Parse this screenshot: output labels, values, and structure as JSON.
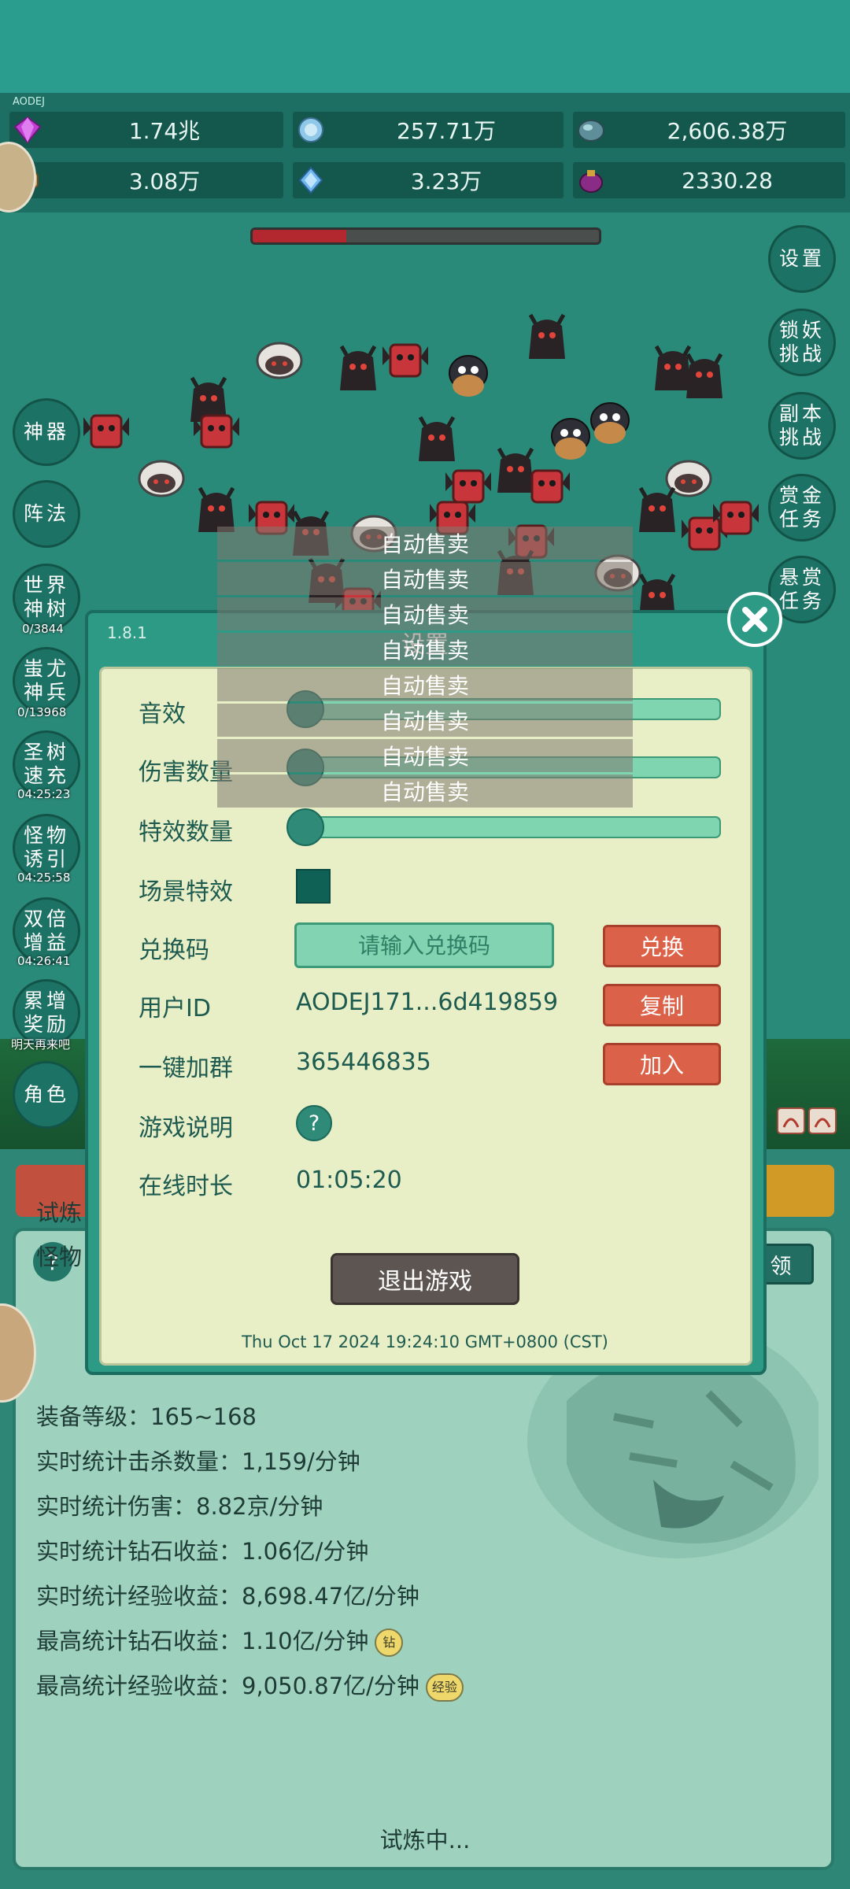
{
  "top_label": "AODEJ",
  "resources": [
    {
      "icon": "purple-gem-icon",
      "value": "1.74兆"
    },
    {
      "icon": "blue-crystal-icon",
      "value": "257.71万"
    },
    {
      "icon": "teal-orb-icon",
      "value": "2,606.38万"
    },
    {
      "icon": "scroll-icon",
      "value": "3.08万"
    },
    {
      "icon": "ice-shard-icon",
      "value": "3.23万"
    },
    {
      "icon": "magenta-pouch-icon",
      "value": "2330.28"
    }
  ],
  "boss_hp_fraction": 0.27,
  "left_buttons": [
    {
      "label": "神器",
      "sub": ""
    },
    {
      "label": "阵法",
      "sub": ""
    },
    {
      "label": "世界神树",
      "sub": "0/3844"
    },
    {
      "label": "蚩尤神兵",
      "sub": "0/13968"
    },
    {
      "label": "圣树速充",
      "sub": "04:25:23"
    },
    {
      "label": "怪物诱引",
      "sub": "04:25:58"
    },
    {
      "label": "双倍增益",
      "sub": "04:26:41"
    },
    {
      "label": "累增奖励",
      "sub": "明天再来吧"
    },
    {
      "label": "角色",
      "sub": ""
    }
  ],
  "right_buttons": [
    {
      "label": "设置"
    },
    {
      "label": "锁妖挑战"
    },
    {
      "label": "副本挑战"
    },
    {
      "label": "赏金任务"
    },
    {
      "label": "悬赏任务"
    }
  ],
  "toasts": [
    "自动售卖",
    "自动售卖",
    "自动售卖",
    "自动售卖",
    "自动售卖",
    "自动售卖",
    "自动售卖",
    "自动售卖"
  ],
  "settings": {
    "version": "1.8.1",
    "title": "设置",
    "sound_label": "音效",
    "damage_count_label": "伤害数量",
    "effect_count_label": "特效数量",
    "scene_effect_label": "场景特效",
    "redeem_label": "兑换码",
    "redeem_placeholder": "请输入兑换码",
    "redeem_button": "兑换",
    "user_id_label": "用户ID",
    "user_id_value": "AODEJ171...6d419859",
    "copy_button": "复制",
    "join_group_label": "一键加群",
    "group_number": "365446835",
    "join_button": "加入",
    "guide_label": "游戏说明",
    "guide_button": "?",
    "online_time_label": "在线时长",
    "online_time_value": "01:05:20",
    "exit_button": "退出游戏",
    "timestamp": "Thu Oct 17 2024 19:24:10 GMT+0800 (CST)",
    "sound_level": 0,
    "damage_level": 0,
    "effect_level": 0,
    "scene_effect_checked": true
  },
  "lower": {
    "help": "?",
    "right_tab": "领",
    "stats_partial": [
      "试炼",
      "怪物"
    ],
    "stats": [
      "装备等级：165~168",
      "实时统计击杀数量：1,159/分钟",
      "实时统计伤害：8.82京/分钟",
      "实时统计钻石收益：1.06亿/分钟",
      "实时统计经验收益：8,698.47亿/分钟",
      "最高统计钻石收益：1.10亿/分钟",
      "最高统计经验收益：9,050.87亿/分钟"
    ],
    "diamond_tag": "钻",
    "exp_tag": "经验",
    "status": "试炼中..."
  },
  "colors": {
    "accent": "#2d9a86",
    "panel": "#e8efc6",
    "red_button": "#db6148",
    "exit_button": "#5c5552"
  }
}
